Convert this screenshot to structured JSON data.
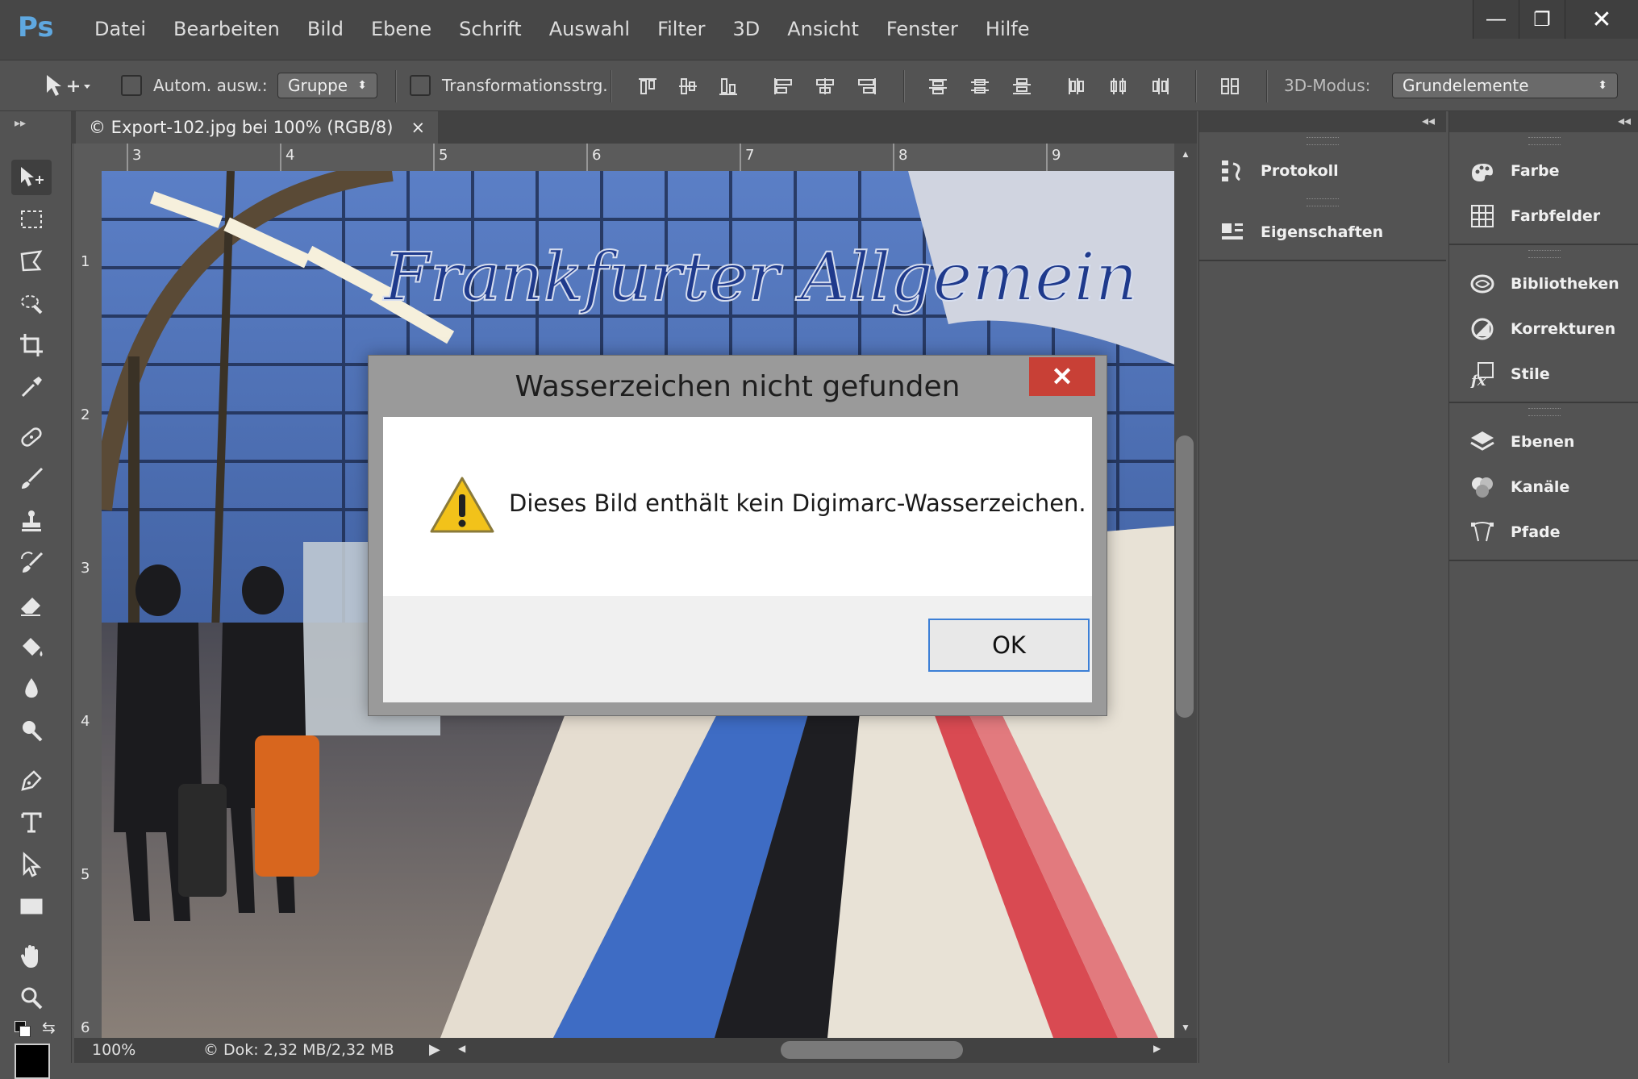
{
  "app": {
    "logo": "Ps"
  },
  "menu": [
    "Datei",
    "Bearbeiten",
    "Bild",
    "Ebene",
    "Schrift",
    "Auswahl",
    "Filter",
    "3D",
    "Ansicht",
    "Fenster",
    "Hilfe"
  ],
  "window_controls": {
    "minimize": "—",
    "restore": "❐",
    "close": "✕"
  },
  "options": {
    "auto_select_label": "Autom. ausw.:",
    "auto_select_value": "Gruppe",
    "transform_label": "Transformationsstrg.",
    "mode3d_label": "3D-Modus:",
    "mode3d_value": "Grundelemente"
  },
  "document": {
    "tab_title": "© Export-102.jpg bei 100% (RGB/8)",
    "tab_close": "×",
    "zoom": "100%",
    "doc_info": "© Dok: 2,32 MB/2,32 MB"
  },
  "ruler": {
    "top": [
      "3",
      "4",
      "5",
      "6",
      "7",
      "8",
      "9"
    ],
    "left": [
      "1",
      "2",
      "3",
      "4",
      "5",
      "6"
    ]
  },
  "panels": {
    "left_column": [
      {
        "label": "Protokoll",
        "icon": "history-icon"
      },
      {
        "label": "Eigenschaften",
        "icon": "properties-icon"
      }
    ],
    "right_column_group1": [
      {
        "label": "Farbe",
        "icon": "color-icon"
      },
      {
        "label": "Farbfelder",
        "icon": "swatches-icon"
      }
    ],
    "right_column_group2": [
      {
        "label": "Bibliotheken",
        "icon": "libraries-icon"
      },
      {
        "label": "Korrekturen",
        "icon": "adjustments-icon"
      },
      {
        "label": "Stile",
        "icon": "styles-icon"
      }
    ],
    "right_column_group3": [
      {
        "label": "Ebenen",
        "icon": "layers-icon"
      },
      {
        "label": "Kanäle",
        "icon": "channels-icon"
      },
      {
        "label": "Pfade",
        "icon": "paths-icon"
      }
    ]
  },
  "dialog": {
    "title": "Wasserzeichen nicht gefunden",
    "message": "Dieses Bild enthält kein Digimarc-Wasserzeichen.",
    "ok_label": "OK",
    "close_glyph": "✕"
  },
  "colors": {
    "ui_background": "#535353",
    "menubar": "#474747",
    "dialog_close": "#c84036",
    "ok_border": "#3c7fd6",
    "ps_logo": "#5fa8e0"
  }
}
